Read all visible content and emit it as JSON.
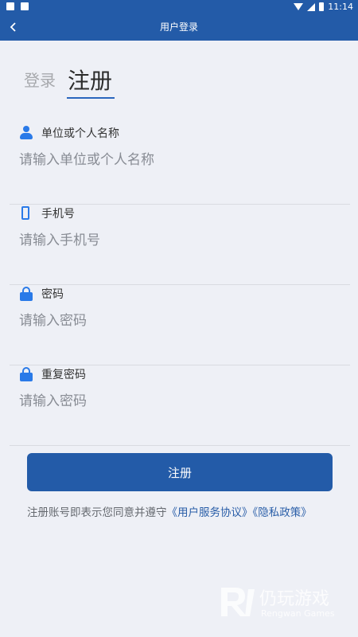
{
  "status_bar": {
    "time": "11:14"
  },
  "header": {
    "title": "用户登录"
  },
  "tabs": {
    "login": "登录",
    "register": "注册"
  },
  "fields": [
    {
      "label": "单位或个人名称",
      "placeholder": "请输入单位或个人名称",
      "icon": "user-icon"
    },
    {
      "label": "手机号",
      "placeholder": "请输入手机号",
      "icon": "phone-icon"
    },
    {
      "label": "密码",
      "placeholder": "请输入密码",
      "icon": "lock-icon"
    },
    {
      "label": "重复密码",
      "placeholder": "请输入密码",
      "icon": "lock-icon"
    }
  ],
  "submit": {
    "label": "注册"
  },
  "agreement": {
    "prefix": "注册账号即表示您同意并遵守",
    "terms": "《用户服务协议》",
    "privacy": "《隐私政策》"
  },
  "watermark": {
    "name": "仍玩游戏",
    "sub": "Rengwan Games"
  },
  "colors": {
    "primary": "#235ba8",
    "icon": "#2a7ae8",
    "link": "#2a5ea8",
    "background": "#eef0f6"
  }
}
